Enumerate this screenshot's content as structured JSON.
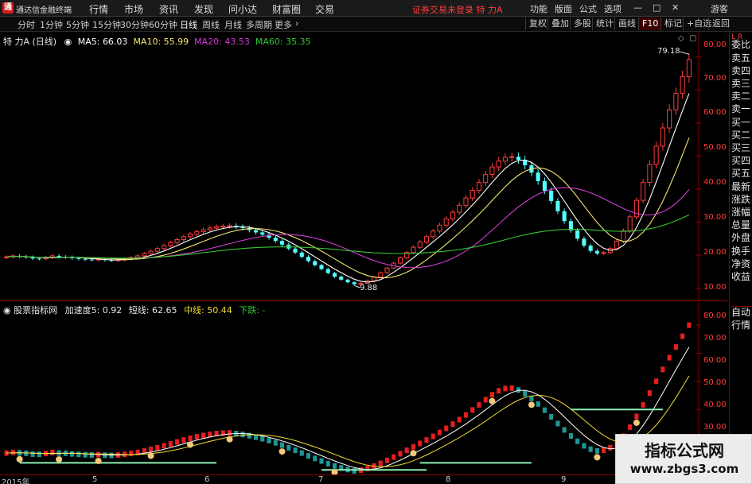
{
  "app": {
    "name": "通达信金融终端",
    "logo_glyph": "通",
    "menu": [
      "行情",
      "市场",
      "资讯",
      "发现",
      "问小达",
      "财富圈",
      "交易"
    ],
    "warning": "证券交易未登录 特 力A",
    "right_menu": [
      "功能",
      "版面",
      "公式",
      "选项",
      "游客"
    ],
    "window_controls": [
      "—",
      "□",
      "✕"
    ]
  },
  "toolbar": {
    "timeframes": [
      "分时",
      "1分钟",
      "5分钟",
      "15分钟",
      "30分钟",
      "60分钟",
      "日线",
      "周线",
      "月线",
      "多周期",
      "更多"
    ],
    "active_timeframe": "日线",
    "right_tools": [
      "复权",
      "叠加",
      "多股",
      "统计",
      "画线",
      "F10",
      "标记",
      "+自选",
      "返回"
    ]
  },
  "main_chart": {
    "stock_label": "特 力A (日线)",
    "ma": [
      {
        "name": "MA5",
        "value": "66.03",
        "color": "#ffffff"
      },
      {
        "name": "MA10",
        "value": "55.99",
        "color": "#f5e66e"
      },
      {
        "name": "MA20",
        "value": "43.53",
        "color": "#d23cd2"
      },
      {
        "name": "MA60",
        "value": "35.35",
        "color": "#32c832"
      }
    ],
    "high_label": "79.18",
    "low_label": "9.88",
    "axis_ticks": [
      "80.00",
      "70.00",
      "60.00",
      "50.00",
      "40.00",
      "30.00",
      "20.00",
      "10.00"
    ],
    "corner_icons": [
      "◇",
      "▢"
    ]
  },
  "indicator_chart": {
    "name": "股票指标网",
    "params": [
      {
        "text": "加速度5: 0.92",
        "color": "#e6e6e6"
      },
      {
        "text": "短线: 62.65",
        "color": "#e6e6e6"
      },
      {
        "text": "中线: 50.44",
        "color": "#f0dc32"
      },
      {
        "text": "下跌: -",
        "color": "#32c832"
      }
    ],
    "axis_ticks": [
      "80.00",
      "70.00",
      "60.00",
      "50.00",
      "40.00",
      "30.00"
    ]
  },
  "right_sidebar": {
    "header": "L R",
    "items": [
      "委比",
      "卖五",
      "卖四",
      "卖三",
      "卖二",
      "卖一",
      "买一",
      "买二",
      "买三",
      "买四",
      "买五",
      "最新",
      "涨跌",
      "涨幅",
      "总量",
      "外盘",
      "换手",
      "净资",
      "收益"
    ],
    "bottom_items": [
      "自动",
      "行情"
    ]
  },
  "time_axis": {
    "labels": [
      "2015年",
      "5",
      "6",
      "7",
      "8",
      "9"
    ]
  },
  "watermark": {
    "line1": "指标公式网",
    "line2": "www.zbgs3.com"
  },
  "chart_data": {
    "type": "candlestick",
    "title": "特 力A (日线)",
    "ylim": [
      8,
      84
    ],
    "close_series": [
      19.5,
      19.8,
      19.6,
      19.4,
      19.0,
      18.9,
      19.3,
      19.8,
      19.5,
      19.4,
      19.1,
      18.9,
      18.7,
      18.6,
      18.8,
      18.5,
      18.4,
      18.6,
      18.9,
      19.3,
      19.8,
      20.5,
      21.2,
      22.0,
      22.9,
      23.8,
      24.7,
      25.6,
      26.4,
      27.1,
      27.7,
      28.2,
      28.6,
      28.8,
      28.9,
      28.6,
      28.2,
      27.6,
      26.9,
      26.2,
      25.3,
      24.3,
      23.2,
      22.0,
      20.8,
      19.5,
      18.2,
      17.0,
      15.8,
      14.6,
      13.5,
      12.6,
      11.8,
      11.2,
      11.5,
      12.3,
      13.4,
      14.7,
      16.1,
      17.6,
      19.2,
      20.8,
      22.4,
      24.0,
      25.6,
      27.3,
      29.1,
      31.0,
      33.0,
      35.1,
      37.3,
      39.6,
      42.0,
      44.4,
      46.7,
      48.5,
      49.6,
      49.8,
      48.9,
      47.2,
      45.0,
      42.4,
      39.5,
      36.4,
      33.3,
      30.3,
      27.5,
      25.0,
      22.9,
      21.3,
      20.5,
      20.8,
      22.0,
      24.2,
      27.4,
      31.6,
      36.6,
      42.0,
      47.5,
      53.0,
      58.5,
      64.0,
      69.0,
      74.0,
      79.18
    ],
    "indicator": {
      "name": "股票指标网",
      "params": [
        "加速度5: 0.92",
        "短线: 62.65",
        "中线: 50.44",
        "下跌: -"
      ],
      "ylim": [
        28,
        84
      ]
    }
  }
}
